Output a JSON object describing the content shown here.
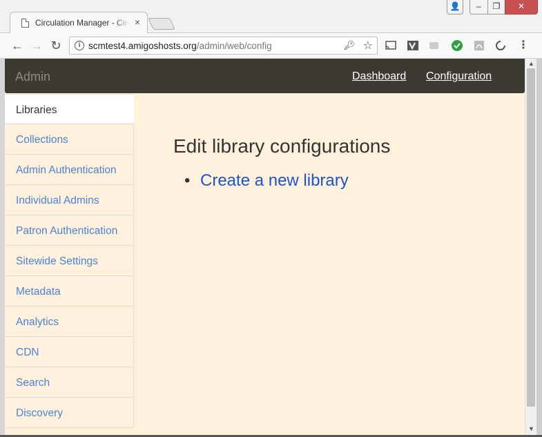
{
  "browser": {
    "tab_title": "Circulation Manager - Circulation Manager",
    "tab_close": "×",
    "url_host": "scmtest4.amigoshosts.org",
    "url_path": "/admin/web/config",
    "window_user": "👤",
    "window_min": "–",
    "window_max": "❐",
    "window_close": "✕",
    "nav_back": "←",
    "nav_forward": "→",
    "nav_reload": "↻"
  },
  "navbar": {
    "brand": "Admin",
    "links": [
      {
        "label": "Dashboard"
      },
      {
        "label": "Configuration"
      }
    ]
  },
  "sidebar": {
    "items": [
      {
        "label": "Libraries",
        "active": true
      },
      {
        "label": "Collections"
      },
      {
        "label": "Admin Authentication"
      },
      {
        "label": "Individual Admins"
      },
      {
        "label": "Patron Authentication"
      },
      {
        "label": "Sitewide Settings"
      },
      {
        "label": "Metadata"
      },
      {
        "label": "Analytics"
      },
      {
        "label": "CDN"
      },
      {
        "label": "Search"
      },
      {
        "label": "Discovery"
      }
    ]
  },
  "main": {
    "title": "Edit library configurations",
    "links": [
      {
        "label": "Create a new library"
      }
    ]
  },
  "colors": {
    "navbar_bg": "#3d3a33",
    "page_bg": "#fff1dc",
    "link": "#1a56c8",
    "sidebar_link": "#4a83d8"
  }
}
